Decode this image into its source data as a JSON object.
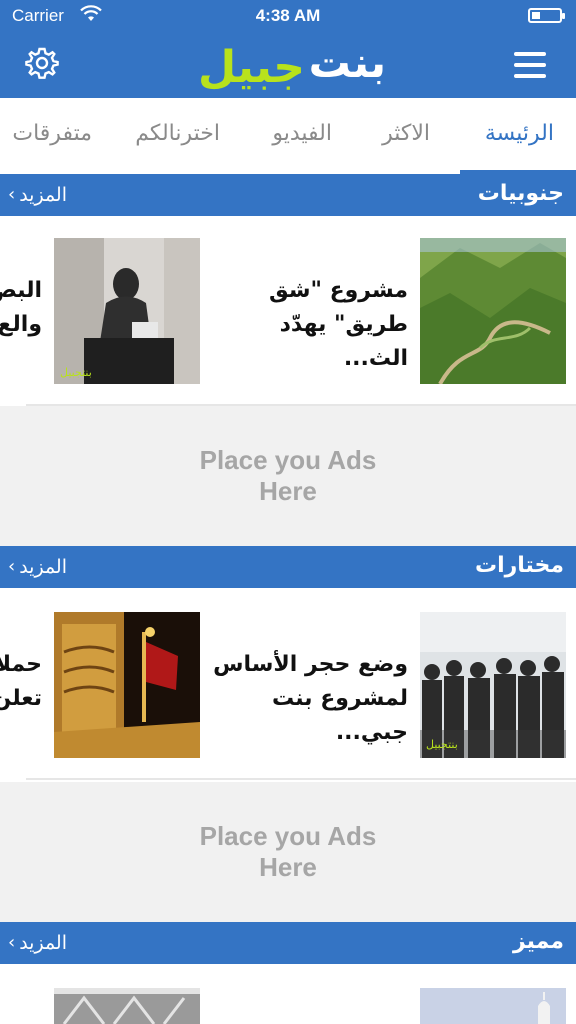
{
  "status_bar": {
    "carrier": "Carrier",
    "time": "4:38 AM",
    "battery_level": 0.3
  },
  "nav": {
    "logo_part1": "بنت",
    "logo_part2": "جبيل",
    "settings_icon": "gear-icon",
    "menu_icon": "hamburger-menu-icon"
  },
  "tabs": [
    "الرئيسة",
    "الاكثر",
    "الفيديو",
    "اخترنالكم",
    "متفرقات"
  ],
  "active_tab_index": 0,
  "more_label": "المزيد",
  "sections": [
    {
      "title": "جنوبيات",
      "articles": [
        {
          "headline": "مشروع \"شق طريق\" يهدّد الث...",
          "clip": "البص والع"
        },
        {
          "headline": ""
        }
      ]
    },
    {
      "title": "مختارات",
      "articles": [
        {
          "headline": "وضع حجر الأساس لمشروع بنت جبي...",
          "clip": "حملا تعلن"
        }
      ]
    },
    {
      "title": "مميز"
    }
  ],
  "ads": [
    {
      "line1": "Place you Ads",
      "line2": "Here"
    },
    {
      "line1": "Place you Ads",
      "line2": "Here"
    }
  ],
  "clip_lines": {
    "s1_l1": "البص",
    "s1_l2": "والع",
    "s2_l1": "حملا",
    "s2_l2": "تعلن"
  },
  "headlines": {
    "s1_l1": "مشروع \"شق",
    "s1_l2": "طريق\" يهدّد الث...",
    "s2_l1": "وضع حجر الأساس",
    "s2_l2": "لمشروع بنت جبي..."
  },
  "colors": {
    "brand": "#3474c4",
    "logo_accent": "#b8e21c",
    "tab_inactive": "#8a8a8a",
    "ad_bg": "#f1f1f1"
  }
}
